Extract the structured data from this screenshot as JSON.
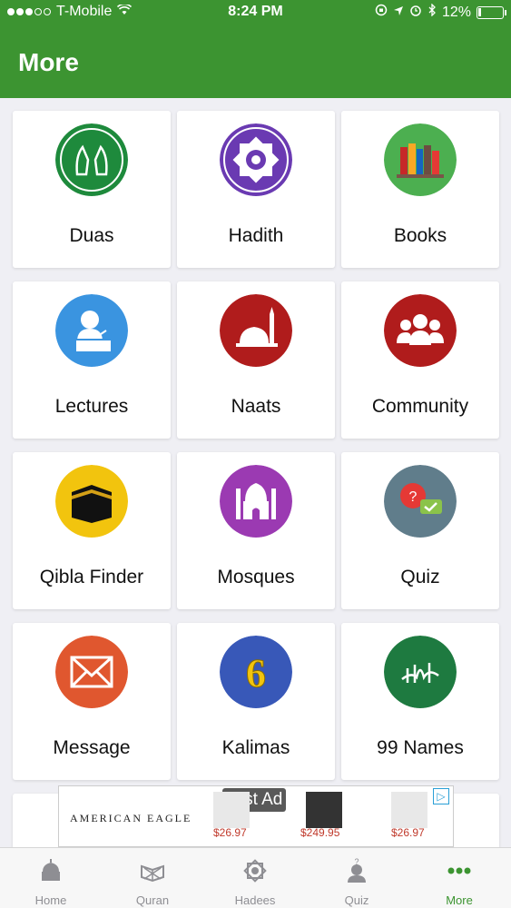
{
  "status_bar": {
    "carrier": "T-Mobile",
    "time": "8:24 PM",
    "battery": "12%",
    "battery_level": 0.12,
    "signal_bars": 3,
    "signal_total": 5
  },
  "nav": {
    "title": "More"
  },
  "tiles": [
    {
      "label": "Duas",
      "icon": "duas-icon",
      "color": "#1e8a3c"
    },
    {
      "label": "Hadith",
      "icon": "hadith-icon",
      "color": "#6a3ab2"
    },
    {
      "label": "Books",
      "icon": "books-icon",
      "color": "#4caf50"
    },
    {
      "label": "Lectures",
      "icon": "lectures-icon",
      "color": "#3a94e0"
    },
    {
      "label": "Naats",
      "icon": "naats-icon",
      "color": "#b01c1c"
    },
    {
      "label": "Community",
      "icon": "community-icon",
      "color": "#b01c1c"
    },
    {
      "label": "Qibla Finder",
      "icon": "kaaba-icon",
      "color": "#f2c40e"
    },
    {
      "label": "Mosques",
      "icon": "mosque-icon",
      "color": "#9b3ab2"
    },
    {
      "label": "Quiz",
      "icon": "quiz-icon",
      "color": "#607d8b"
    },
    {
      "label": "Message",
      "icon": "message-icon",
      "color": "#e0572f"
    },
    {
      "label": "Kalimas",
      "icon": "kalimas-icon",
      "color": "#3858b8",
      "digit": "6"
    },
    {
      "label": "99 Names",
      "icon": "allah-names-icon",
      "color": "#1e7a40"
    }
  ],
  "ad": {
    "label": "Test Ad",
    "brand": "AMERICAN EAGLE",
    "prices": [
      "$26.97",
      "$249.95",
      "$26.97"
    ]
  },
  "tabs": [
    {
      "label": "Home",
      "icon": "home-icon"
    },
    {
      "label": "Quran",
      "icon": "quran-icon"
    },
    {
      "label": "Hadees",
      "icon": "hadees-icon"
    },
    {
      "label": "Quiz",
      "icon": "quiz-tab-icon"
    },
    {
      "label": "More",
      "icon": "more-icon",
      "active": true
    }
  ],
  "colors": {
    "primary": "#3c9431",
    "background": "#efeff4"
  }
}
